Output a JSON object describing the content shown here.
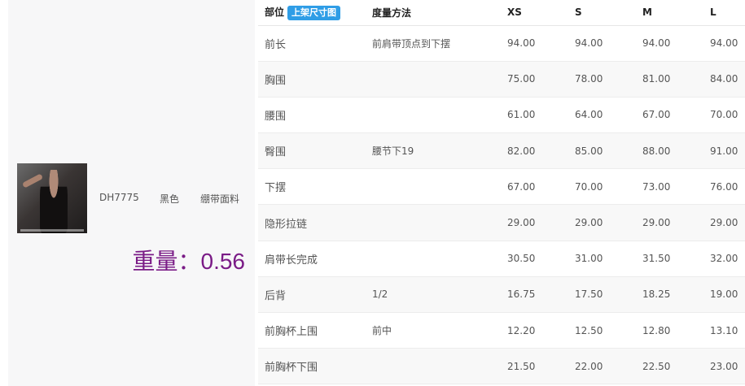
{
  "product": {
    "code": "DH7775",
    "color": "黑色",
    "material": "绷带面料",
    "weight_text": "重量：0.56",
    "thumbnail_icon": "product-photo"
  },
  "table": {
    "headers": {
      "part": "部位",
      "badge": "上架尺寸图",
      "method": "度量方法",
      "xs": "XS",
      "s": "S",
      "m": "M",
      "l": "L"
    },
    "rows": [
      {
        "part": "前长",
        "method": "前肩带顶点到下摆",
        "xs": "94.00",
        "s": "94.00",
        "m": "94.00",
        "l": "94.00"
      },
      {
        "part": "胸围",
        "method": "",
        "xs": "75.00",
        "s": "78.00",
        "m": "81.00",
        "l": "84.00"
      },
      {
        "part": "腰围",
        "method": "",
        "xs": "61.00",
        "s": "64.00",
        "m": "67.00",
        "l": "70.00"
      },
      {
        "part": "臀围",
        "method": "腰节下19",
        "xs": "82.00",
        "s": "85.00",
        "m": "88.00",
        "l": "91.00"
      },
      {
        "part": "下摆",
        "method": "",
        "xs": "67.00",
        "s": "70.00",
        "m": "73.00",
        "l": "76.00"
      },
      {
        "part": "隐形拉链",
        "method": "",
        "xs": "29.00",
        "s": "29.00",
        "m": "29.00",
        "l": "29.00"
      },
      {
        "part": "肩带长完成",
        "method": "",
        "xs": "30.50",
        "s": "31.00",
        "m": "31.50",
        "l": "32.00"
      },
      {
        "part": "后背",
        "method": "1/2",
        "xs": "16.75",
        "s": "17.50",
        "m": "18.25",
        "l": "19.00"
      },
      {
        "part": "前胸杯上围",
        "method": "前中",
        "xs": "12.20",
        "s": "12.50",
        "m": "12.80",
        "l": "13.10"
      },
      {
        "part": "前胸杯下围",
        "method": "",
        "xs": "21.50",
        "s": "22.00",
        "m": "22.50",
        "l": "23.00"
      }
    ]
  },
  "colors": {
    "badge_bg": "#2f9de6",
    "weight_text": "#7a1b86",
    "stripe_row": "#f8f8f8"
  }
}
